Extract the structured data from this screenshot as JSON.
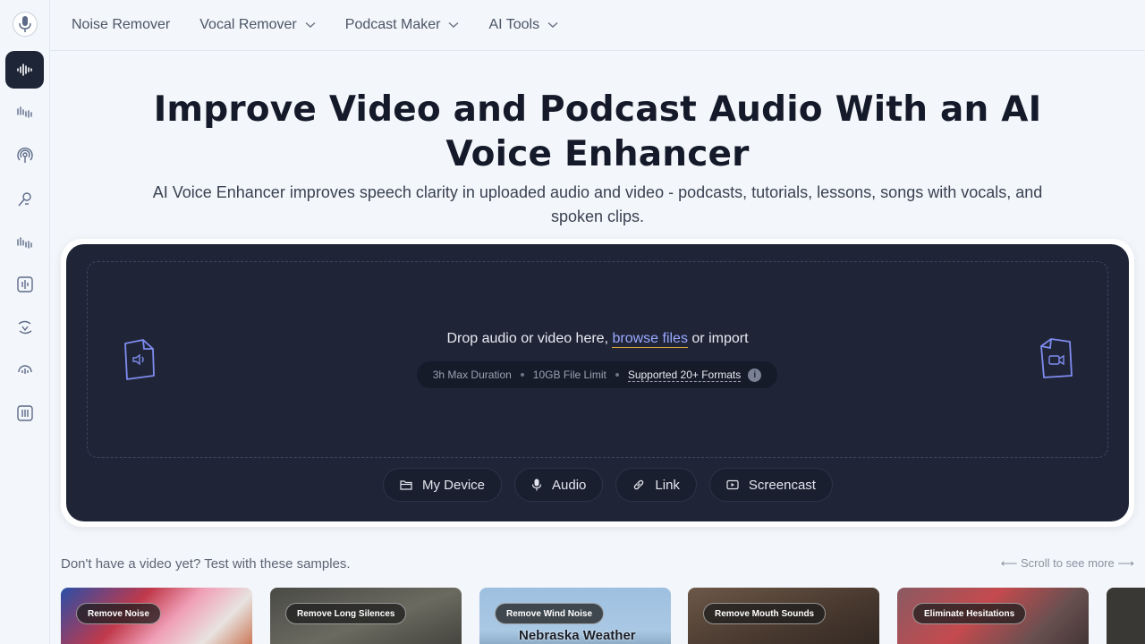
{
  "nav": {
    "items": [
      {
        "label": "Noise Remover",
        "dropdown": false
      },
      {
        "label": "Vocal Remover",
        "dropdown": true
      },
      {
        "label": "Podcast Maker",
        "dropdown": true
      },
      {
        "label": "AI Tools",
        "dropdown": true
      }
    ]
  },
  "sidebar": {
    "icons": [
      "voice-enhancer-icon",
      "waveform-icon",
      "podcast-icon",
      "voice-changer-icon",
      "waveform-icon",
      "audio-editor-icon",
      "translate-icon",
      "speed-icon",
      "equalizer-icon"
    ]
  },
  "hero": {
    "title": "Improve Video and Podcast Audio With an AI Voice Enhancer",
    "subtitle": "AI Voice Enhancer improves speech clarity in uploaded audio and video - podcasts, tutorials, lessons, songs with vocals, and spoken clips."
  },
  "upload": {
    "drop_prefix": "Drop audio or video here, ",
    "browse_label": "browse files",
    "drop_suffix": " or import",
    "max_duration": "3h Max Duration",
    "size_limit": "10GB File Limit",
    "formats": "Supported 20+ Formats",
    "info": "i",
    "buttons": {
      "device": "My Device",
      "audio": "Audio",
      "link": "Link",
      "screencast": "Screencast"
    }
  },
  "samples": {
    "label": "Don't have a video yet? Test with these samples.",
    "scroll_hint": "⟵ Scroll to see more ⟶",
    "cards": [
      {
        "tag": "Remove Noise"
      },
      {
        "tag": "Remove Long Silences"
      },
      {
        "tag": "Remove Wind Noise",
        "caption": "Nebraska Weather"
      },
      {
        "tag": "Remove Mouth Sounds"
      },
      {
        "tag": "Eliminate Hesitations"
      }
    ]
  },
  "colors": {
    "panel": "#1f2537",
    "accent_link": "#9aa8ff",
    "accent_underline": "#d9a43b",
    "sidebar_active": "#1e2537"
  }
}
